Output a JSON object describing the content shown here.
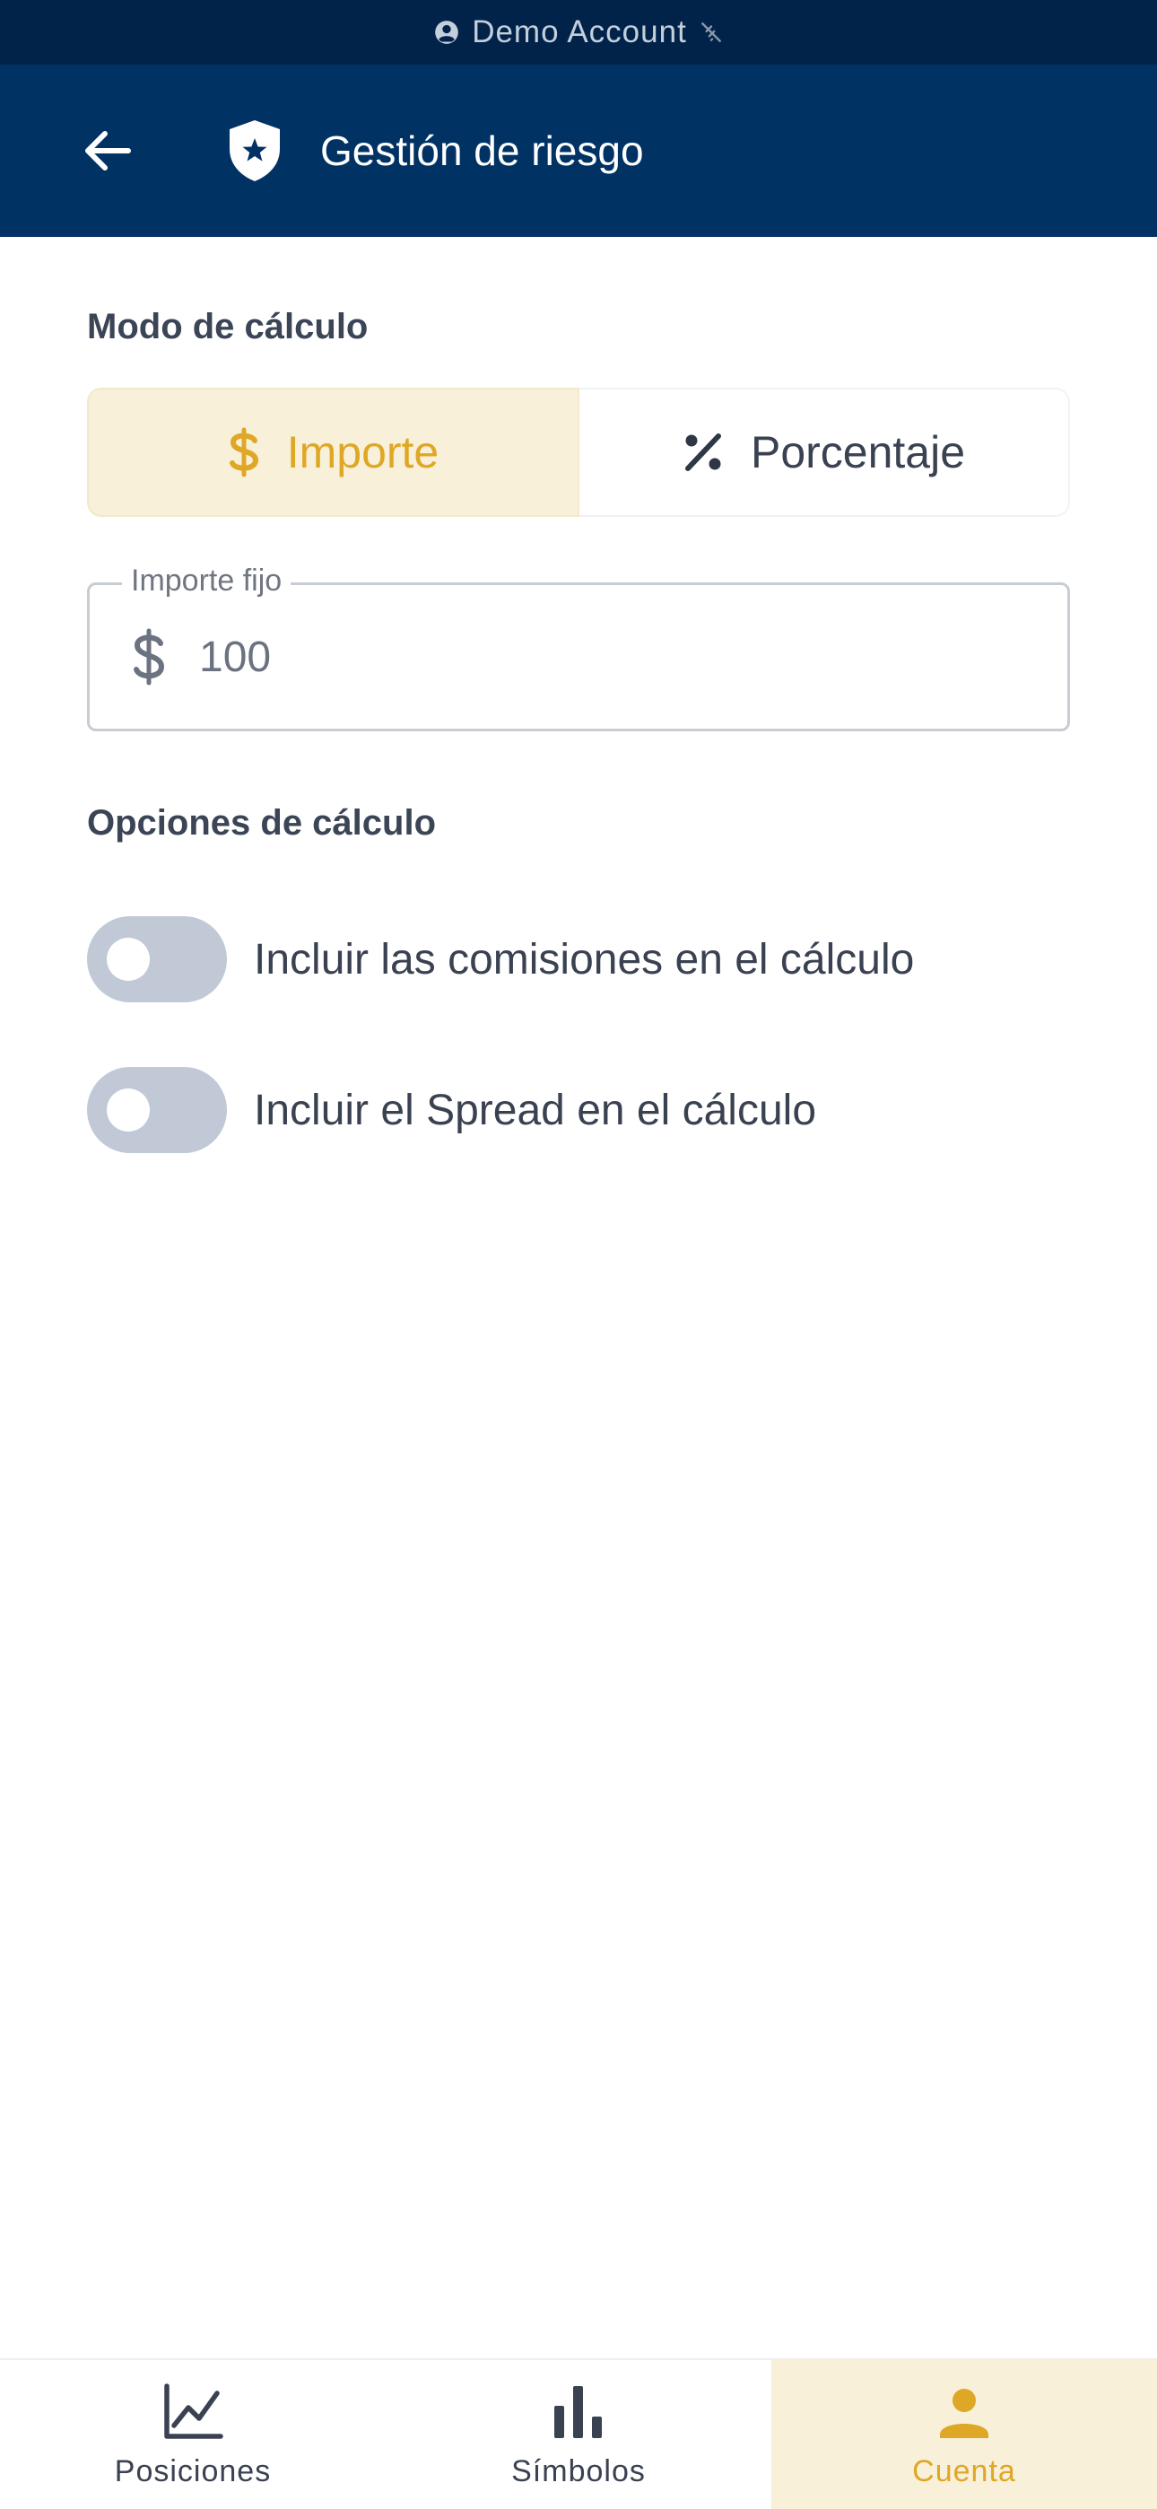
{
  "status_bar": {
    "account_label": "Demo Account",
    "user_icon": "user-circle-icon",
    "signal_icon": "wifi-off-icon"
  },
  "header": {
    "back_icon": "arrow-left-icon",
    "shield_icon": "shield-star-icon",
    "title": "Gestión de riesgo"
  },
  "calc_mode": {
    "section_title": "Modo de cálculo",
    "options": [
      {
        "label": "Importe",
        "icon": "dollar-icon",
        "selected": true
      },
      {
        "label": "Porcentaje",
        "icon": "percent-icon",
        "selected": false
      }
    ]
  },
  "fixed_amount": {
    "label": "Importe fijo",
    "prefix_icon": "dollar-icon",
    "value": "100"
  },
  "calc_options": {
    "section_title": "Opciones de cálculo",
    "toggles": [
      {
        "label": "Incluir las comisiones en el cálculo",
        "enabled": false
      },
      {
        "label": "Incluir el Spread en el cálculo",
        "enabled": false
      }
    ]
  },
  "bottom_nav": {
    "items": [
      {
        "label": "Posiciones",
        "icon": "line-chart-icon",
        "active": false
      },
      {
        "label": "Símbolos",
        "icon": "bar-chart-icon",
        "active": false
      },
      {
        "label": "Cuenta",
        "icon": "person-icon",
        "active": true
      }
    ]
  },
  "colors": {
    "status_bar_bg": "#01234a",
    "header_bg": "#003264",
    "accent": "#dea726",
    "accent_bg": "#f9f0d9",
    "toggle_off": "#c1c9d6",
    "text_primary": "#3a4252"
  }
}
